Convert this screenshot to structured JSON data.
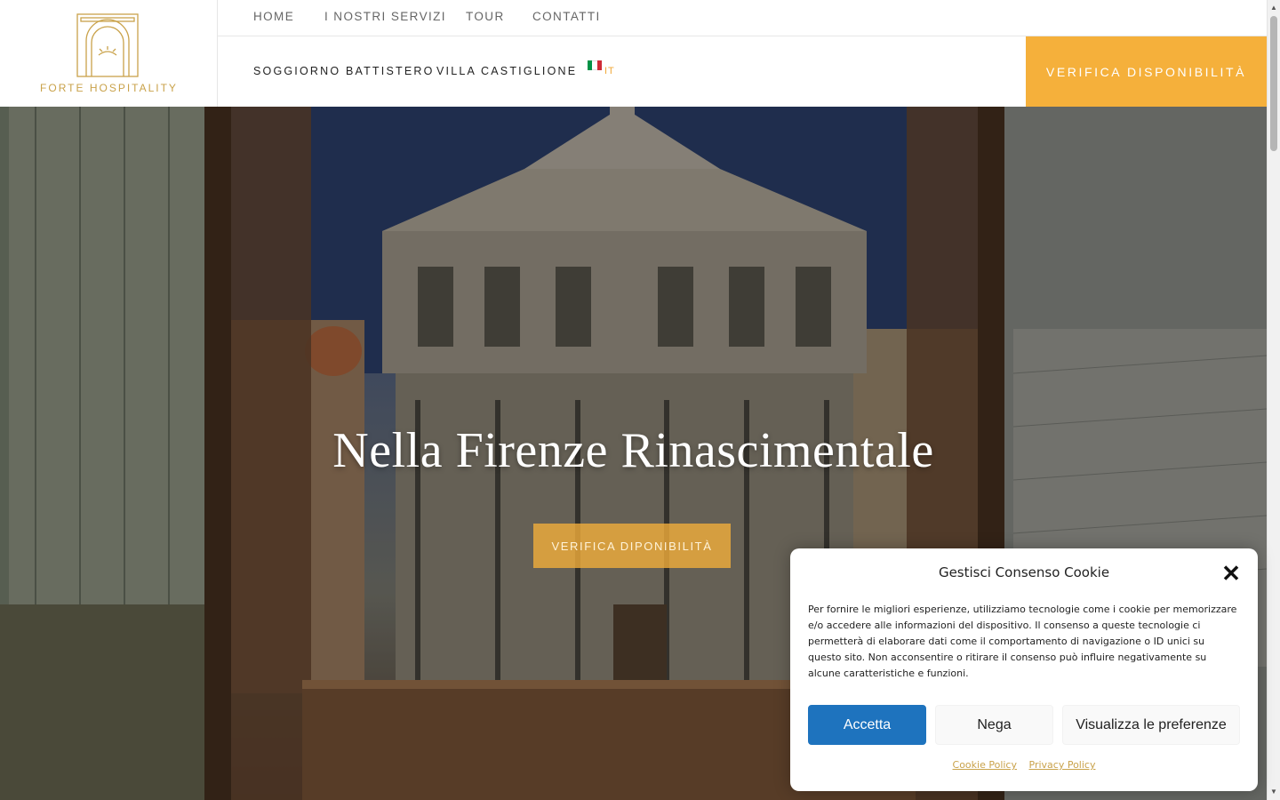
{
  "logo": {
    "text": "FORTE HOSPITALITY",
    "icon": "arch-laurel-icon"
  },
  "topnav": {
    "items": [
      "HOME",
      "I NOSTRI SERVIZI",
      "TOUR",
      "CONTATTI"
    ]
  },
  "subnav": {
    "items": [
      "SOGGIORNO BATTISTERO",
      "VILLA CASTIGLIONE"
    ]
  },
  "language": {
    "code": "IT",
    "flag_colors": [
      "#009246",
      "#ffffff",
      "#ce2b37"
    ]
  },
  "header_cta": {
    "label": "VERIFICA DISPONIBILITÀ"
  },
  "hero": {
    "title": "Nella Firenze Rinascimentale",
    "cta_label": "VERIFICA DIPONIBILITÀ",
    "image_description": "view from a window onto the Baptistery of Florence"
  },
  "cookie": {
    "title": "Gestisci Consenso Cookie",
    "text": "Per fornire le migliori esperienze, utilizziamo tecnologie come i cookie per memorizzare e/o accedere alle informazioni del dispositivo. Il consenso a queste tecnologie ci permetterà di elaborare dati come il comportamento di navigazione o ID unici su questo sito. Non acconsentire o ritirare il consenso può influire negativamente su alcune caratteristiche e funzioni.",
    "accept": "Accetta",
    "deny": "Nega",
    "preferences": "Visualizza le preferenze",
    "links": [
      "Cookie Policy",
      "Privacy Policy"
    ]
  },
  "colors": {
    "accent": "#f5b03b",
    "gold": "#c9a24a",
    "primary_button": "#1e73be"
  }
}
